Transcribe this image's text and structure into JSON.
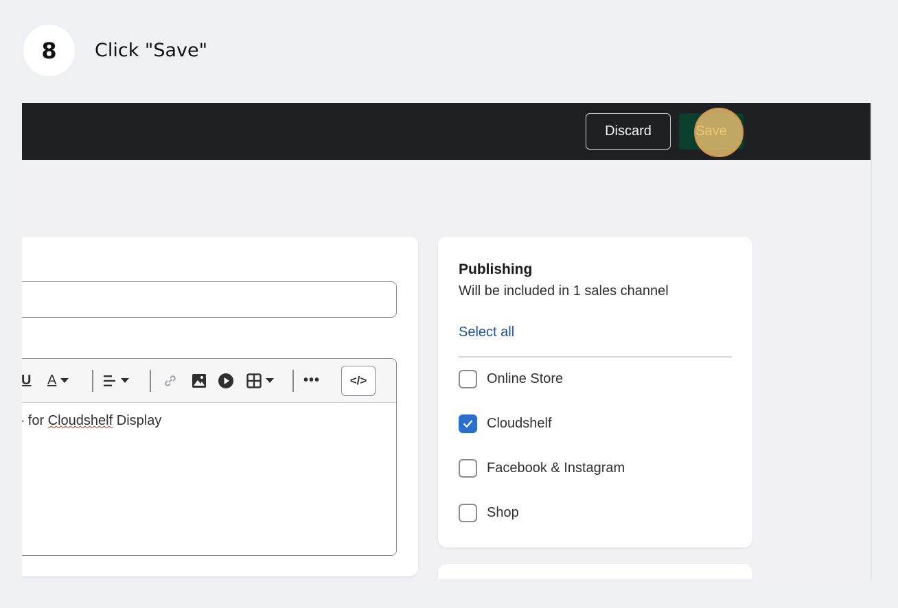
{
  "step": {
    "number": "8",
    "title": "Click \"Save\""
  },
  "topbar": {
    "discard_label": "Discard",
    "save_label": "Save"
  },
  "editor": {
    "text_prefix": "s - for ",
    "text_misspelled": "Cloudshelf",
    "text_suffix": " Display"
  },
  "publishing": {
    "title": "Publishing",
    "subtitle": "Will be included in 1 sales channel",
    "select_all": "Select all",
    "channels": [
      {
        "label": "Online Store",
        "checked": false
      },
      {
        "label": "Cloudshelf",
        "checked": true
      },
      {
        "label": "Facebook & Instagram",
        "checked": false
      },
      {
        "label": "Shop",
        "checked": false
      }
    ]
  },
  "colors": {
    "save_button": "#0b3f2d",
    "highlight": "#e8c06e",
    "checkbox_checked": "#2c6ecb",
    "link": "#1f5199"
  },
  "icons": [
    "underline-icon",
    "text-color-icon",
    "align-icon",
    "link-icon",
    "image-icon",
    "video-icon",
    "table-icon",
    "more-icon",
    "code-icon",
    "checkmark-icon"
  ]
}
